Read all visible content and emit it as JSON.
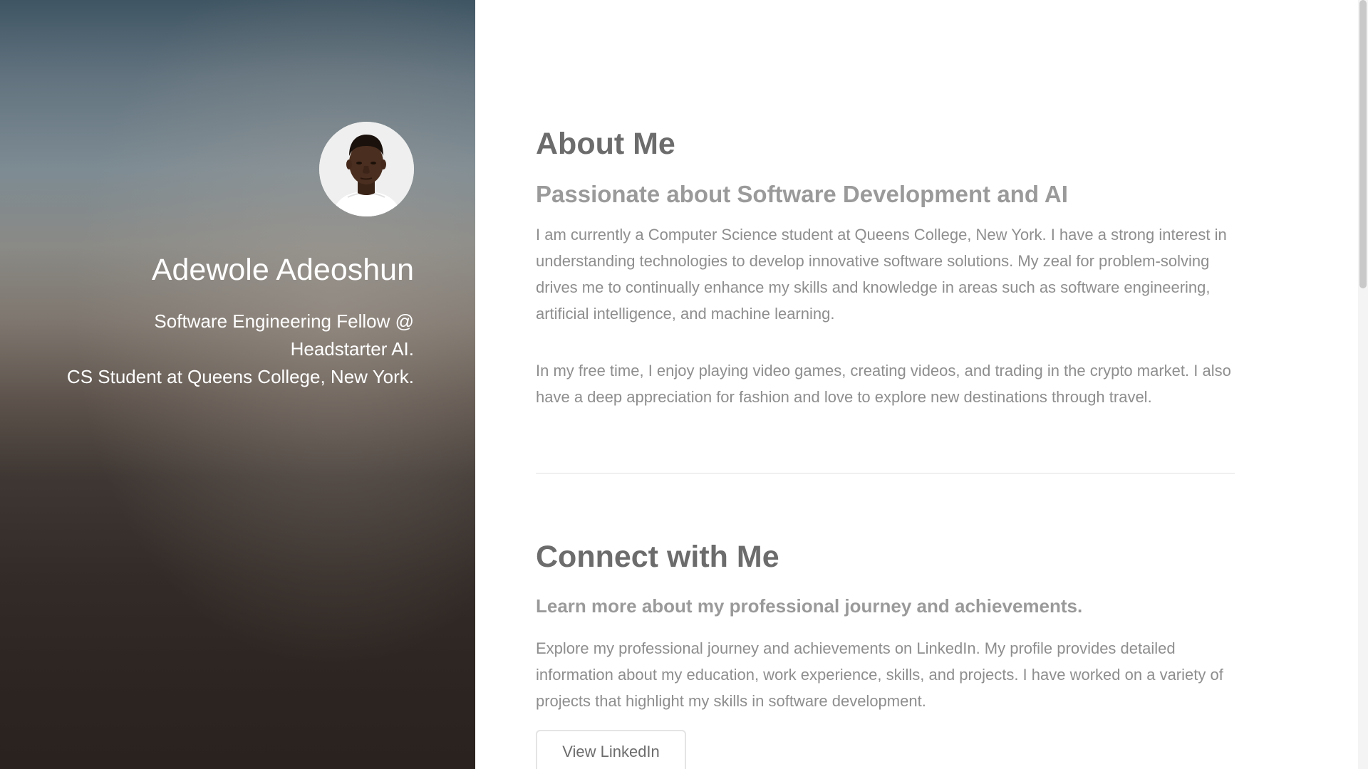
{
  "hero": {
    "name": "Adewole Adeoshun",
    "tagline_line1": "Software Engineering Fellow @",
    "tagline_line2": "Headstarter AI.",
    "tagline_line3": "CS Student at Queens College, New York.",
    "avatar_icon": "profile-photo"
  },
  "about": {
    "title": "About Me",
    "subtitle": "Passionate about Software Development and AI",
    "paragraph1": "I am currently a Computer Science student at Queens College, New York. I have a strong interest in understanding technologies to develop innovative software solutions. My zeal for problem-solving drives me to continually enhance my skills and knowledge in areas such as software engineering, artificial intelligence, and machine learning.",
    "paragraph2": "In my free time, I enjoy playing video games, creating videos, and trading in the crypto market. I also have a deep appreciation for fashion and love to explore new destinations through travel."
  },
  "connect": {
    "title": "Connect with Me",
    "subtitle": "Learn more about my professional journey and achievements.",
    "paragraph": "Explore my professional journey and achievements on LinkedIn. My profile provides detailed information about my education, work experience, skills, and projects. I have worked on a variety of projects that highlight my skills in software development.",
    "button_label": "View LinkedIn"
  },
  "colors": {
    "heading": "#6c6c6c",
    "subheading": "#9a9a9a",
    "body_text": "#8e8e8e",
    "hero_text": "#ffffff"
  }
}
